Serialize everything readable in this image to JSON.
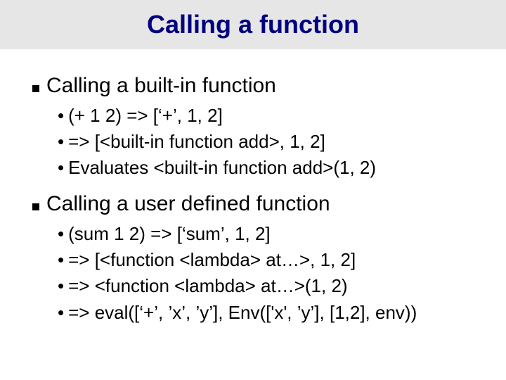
{
  "title": "Calling a function",
  "sections": [
    {
      "heading": "Calling a built-in function",
      "items": [
        "(+ 1 2) => [‘+’, 1, 2]",
        "=> [<built-in function add>, 1, 2]",
        "Evaluates <built-in function add>(1, 2)"
      ]
    },
    {
      "heading": "Calling a user defined function",
      "items": [
        "(sum 1 2) => [‘sum’, 1, 2]",
        "=> [<function <lambda> at…>, 1, 2]",
        "=> <function <lambda> at…>(1, 2)",
        "=> eval([‘+’, ’x’, ’y’], Env(['x', ’y’], [1,2], env))"
      ]
    }
  ]
}
